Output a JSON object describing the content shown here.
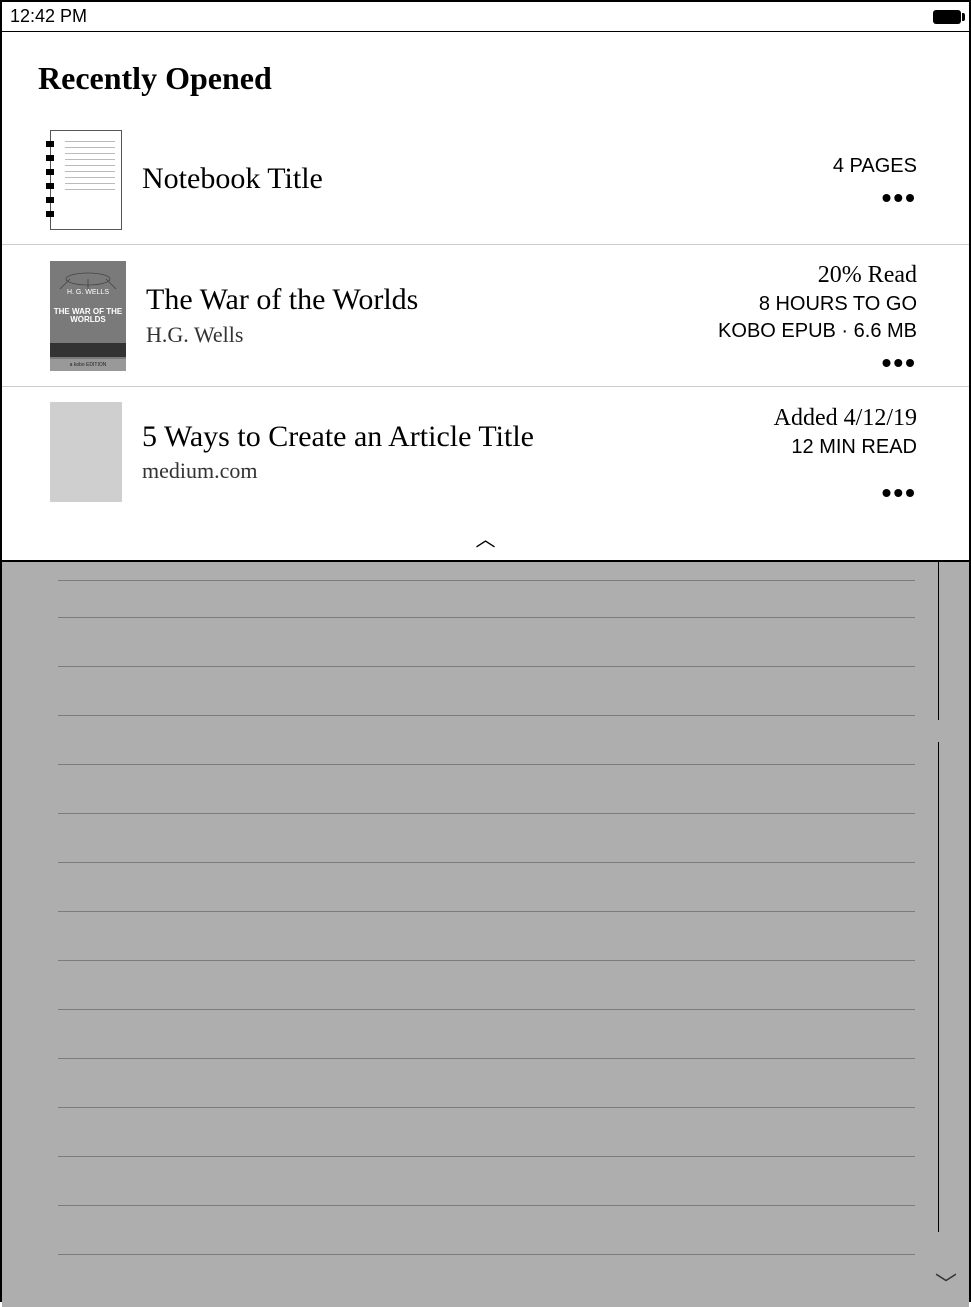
{
  "status": {
    "time": "12:42 PM"
  },
  "section_title": "Recently Opened",
  "items": [
    {
      "title": "Notebook Title",
      "subtitle": "",
      "meta1": "4 PAGES",
      "meta2": "",
      "meta3": ""
    },
    {
      "title": "The War of the Worlds",
      "subtitle": "H.G. Wells",
      "meta1": "20% Read",
      "meta2": "8 HOURS TO GO",
      "meta3": "KOBO EPUB · 6.6 MB",
      "cover_author": "H. G. WELLS",
      "cover_title": "THE WAR OF THE WORLDS",
      "cover_edition": "a kobo EDITION"
    },
    {
      "title": "5 Ways to Create an Article Title",
      "subtitle": "medium.com",
      "meta1": "Added 4/12/19",
      "meta2": "12 MIN READ",
      "meta3": ""
    }
  ]
}
